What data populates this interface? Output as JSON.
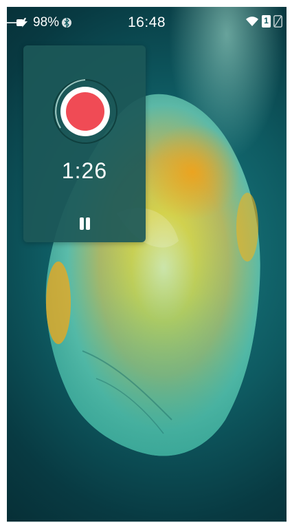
{
  "status_bar": {
    "battery_percent": "98%",
    "time": "16:48",
    "sim_slot": "1",
    "icons": [
      "charging-plug-icon",
      "bluetooth-icon",
      "wifi-icon",
      "sim-card-icon",
      "sim-card-empty-icon"
    ]
  },
  "recorder_widget": {
    "elapsed_time": "1:26",
    "record_color": "#f04b55",
    "icons": [
      "record-icon",
      "pause-icon"
    ]
  },
  "colors": {
    "widget_bg": "#1c5858",
    "crystal_yellow": "#f2c21c",
    "crystal_teal": "#3fb9a8"
  }
}
